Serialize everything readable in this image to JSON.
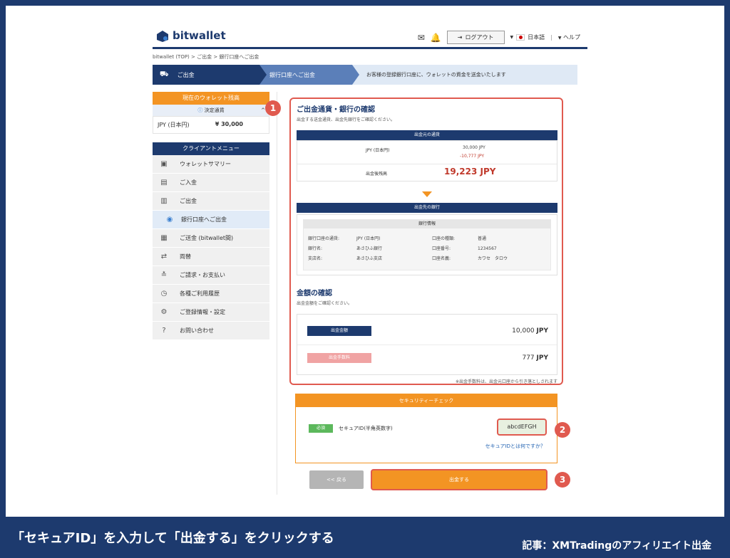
{
  "header": {
    "logo_text": "bitwallet",
    "logout_label": "ログアウト",
    "language": "日本語",
    "help_label": "ヘルプ"
  },
  "breadcrumb": "bitwallet (TOP)  >  ご出金  >  銀行口座へご出金",
  "steps": {
    "step1": "ご出金",
    "step2": "銀行口座へご出金",
    "message": "お客様の登録銀行口座に、ウォレットの資金を送金いたします"
  },
  "sidebar": {
    "wallet_header": "現在のウォレット残高",
    "wallet_sub": "決定通貨",
    "wallet_currency": "JPY (日本円)",
    "wallet_amount": "¥ 30,000",
    "menu_header": "クライアントメニュー",
    "items": [
      {
        "label": "ウォレットサマリー",
        "icon": "wallet-icon"
      },
      {
        "label": "ご入金",
        "icon": "deposit-icon"
      },
      {
        "label": "ご出金",
        "icon": "withdraw-icon"
      },
      {
        "label": "銀行口座へご出金",
        "icon": "bank-icon"
      },
      {
        "label": "ご送金 (bitwallet間)",
        "icon": "transfer-icon"
      },
      {
        "label": "両替",
        "icon": "exchange-icon"
      },
      {
        "label": "ご請求・お支払い",
        "icon": "invoice-icon"
      },
      {
        "label": "各種ご利用履歴",
        "icon": "history-icon"
      },
      {
        "label": "ご登録情報・設定",
        "icon": "gear-icon"
      },
      {
        "label": "お問い合わせ",
        "icon": "help-icon"
      }
    ]
  },
  "confirm": {
    "title": "ご出金通貨・銀行の確認",
    "subtitle": "出金する送金通貨、出金先銀行をご確認ください。",
    "source_header": "出金元の通貨",
    "currency_label": "JPY (日本円)",
    "amount1": "30,000 JPY",
    "amount2": "-10,777 JPY",
    "balance_label": "出金後残高",
    "balance_value": "19,223 JPY",
    "dest_header": "出金先の銀行",
    "bank_info_header": "銀行情報",
    "bank_fields": {
      "k1": "銀行口座の通貨:",
      "v1": "JPY (日本円)",
      "k2": "銀行名:",
      "v2": "あさひふ銀行",
      "k3": "支店名:",
      "v3": "あさひふ支店",
      "k4": "口座の種類:",
      "v4": "普通",
      "k5": "口座番号:",
      "v5": "1234567",
      "k6": "口座名義:",
      "v6": "カワセ　タロウ"
    }
  },
  "amount": {
    "title": "金額の確認",
    "subtitle": "出金金額をご確認ください。",
    "row1_label": "出金金額",
    "row1_value": "10,000",
    "row2_label": "出金手数料",
    "row2_value": "777",
    "unit": "JPY",
    "note": "※出金手数料は、出金元口座から引き落としされます"
  },
  "security": {
    "header": "セキュリティーチェック",
    "required": "必須",
    "label": "セキュアID(半角英数字)",
    "value": "abcdEFGH",
    "link": "セキュアIDとは何ですか？"
  },
  "buttons": {
    "back": "<< 戻る",
    "submit": "出金する"
  },
  "badges": [
    "1",
    "2",
    "3"
  ],
  "caption": {
    "main": "「セキュアID」を入力して「出金する」をクリックする",
    "source": "記事：XMTradingのアフィリエイト出金"
  },
  "colors": {
    "navy": "#1d3a6e",
    "orange": "#f39423",
    "red": "#e05a4f",
    "balance_red": "#c0392b"
  }
}
